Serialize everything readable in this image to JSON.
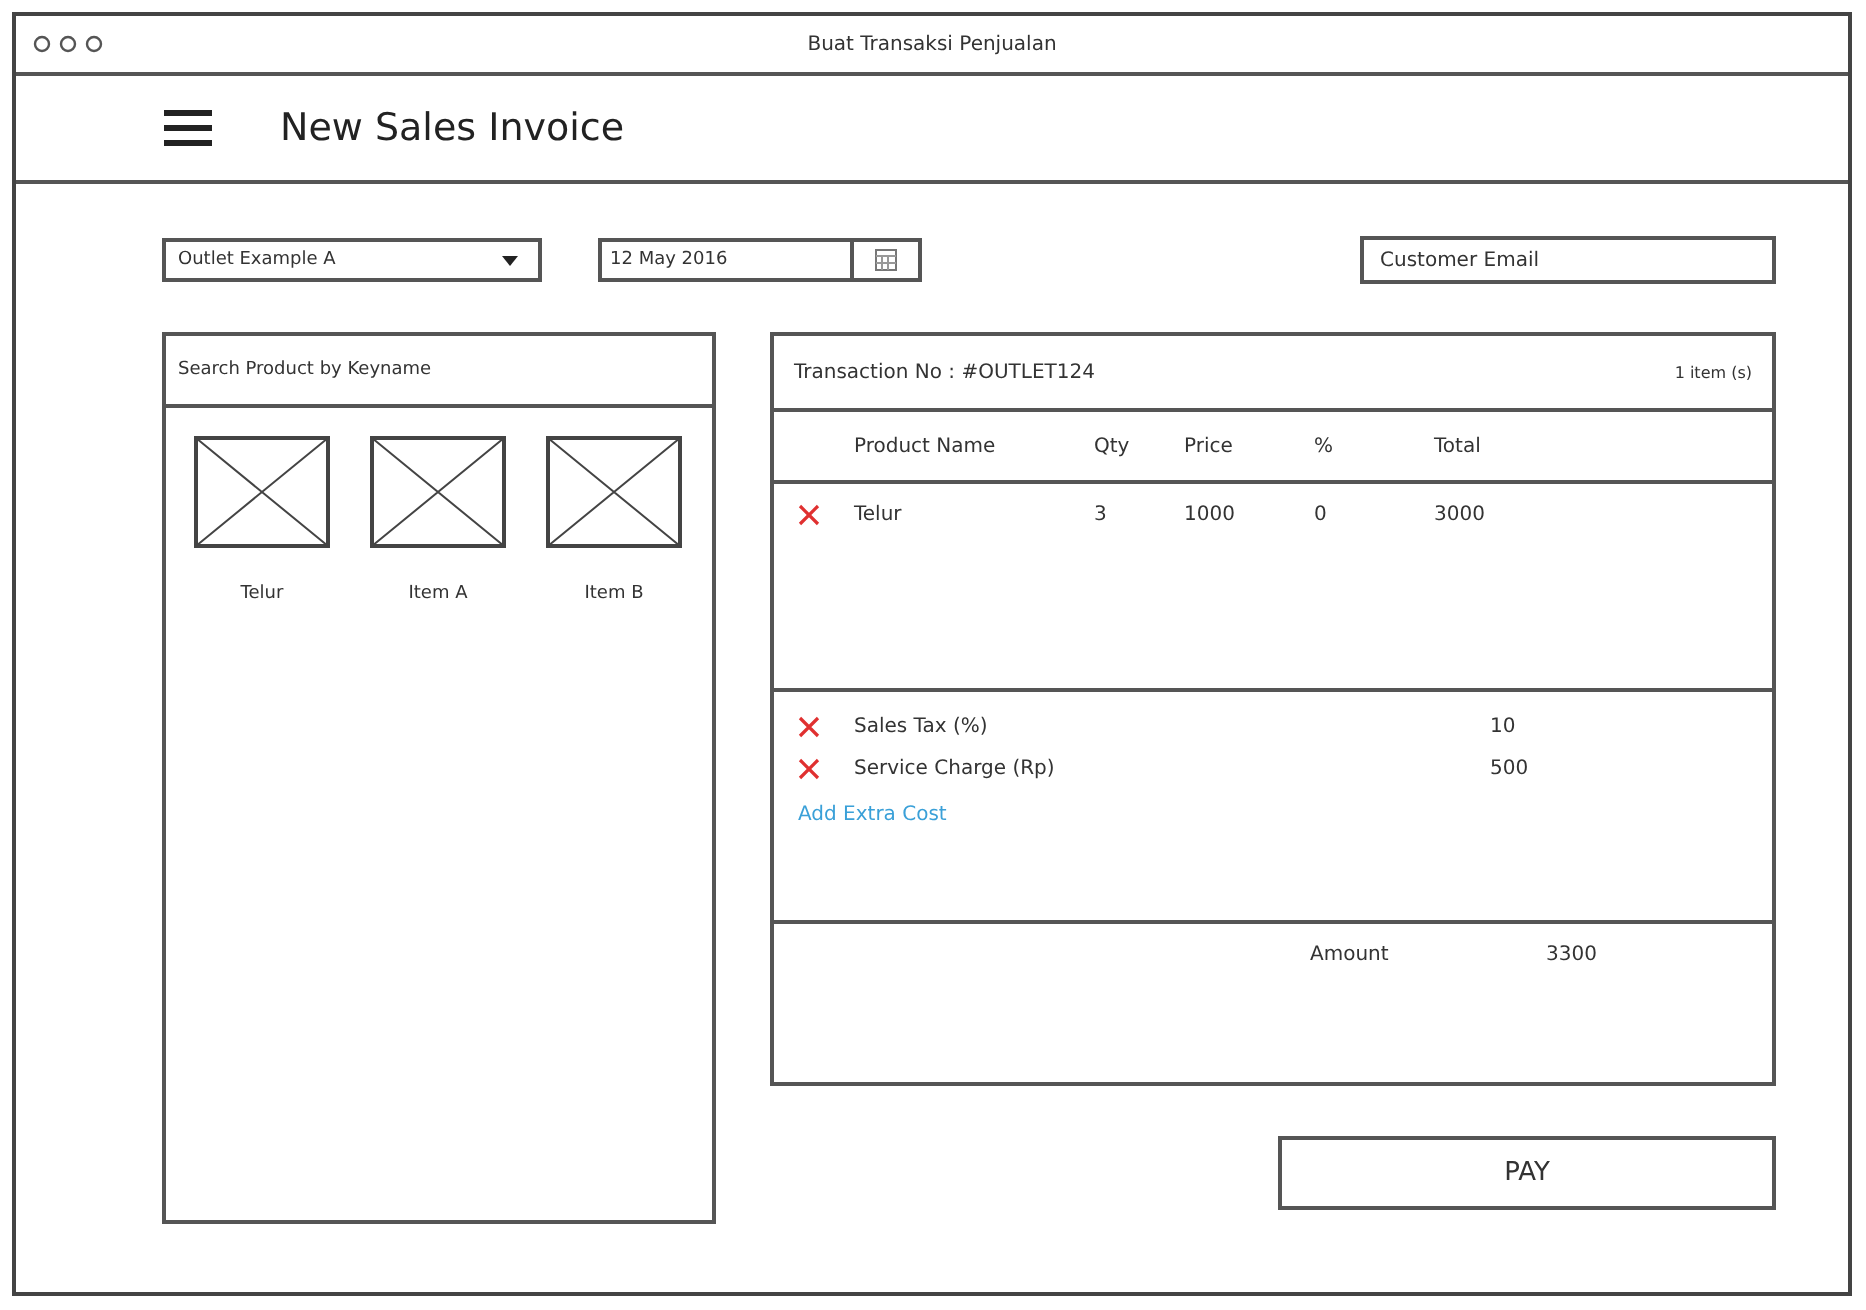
{
  "window": {
    "title": "Buat Transaksi Penjualan"
  },
  "header": {
    "title": "New Sales Invoice"
  },
  "outlet_select": {
    "value": "Outlet Example A"
  },
  "date_field": {
    "value": "12 May 2016"
  },
  "email_field": {
    "placeholder": "Customer Email"
  },
  "product_panel": {
    "search_placeholder": "Search Product by Keyname",
    "products": [
      {
        "name": "Telur"
      },
      {
        "name": "Item A"
      },
      {
        "name": "Item B"
      }
    ]
  },
  "transaction": {
    "number_label": "Transaction No : #OUTLET124",
    "item_count": "1 item (s)",
    "columns": [
      "Product Name",
      "Qty",
      "Price",
      "%",
      "Total"
    ],
    "rows": [
      {
        "cells": [
          "Telur",
          "3",
          "1000",
          "0",
          "3000"
        ]
      }
    ],
    "extra_costs": [
      {
        "label": "Sales Tax (%)",
        "value": "10"
      },
      {
        "label": "Service Charge (Rp)",
        "value": "500"
      }
    ],
    "add_extra_cost": "Add Extra Cost",
    "amount_label": "Amount",
    "amount_value": "3300"
  },
  "pay_button": "PAY"
}
